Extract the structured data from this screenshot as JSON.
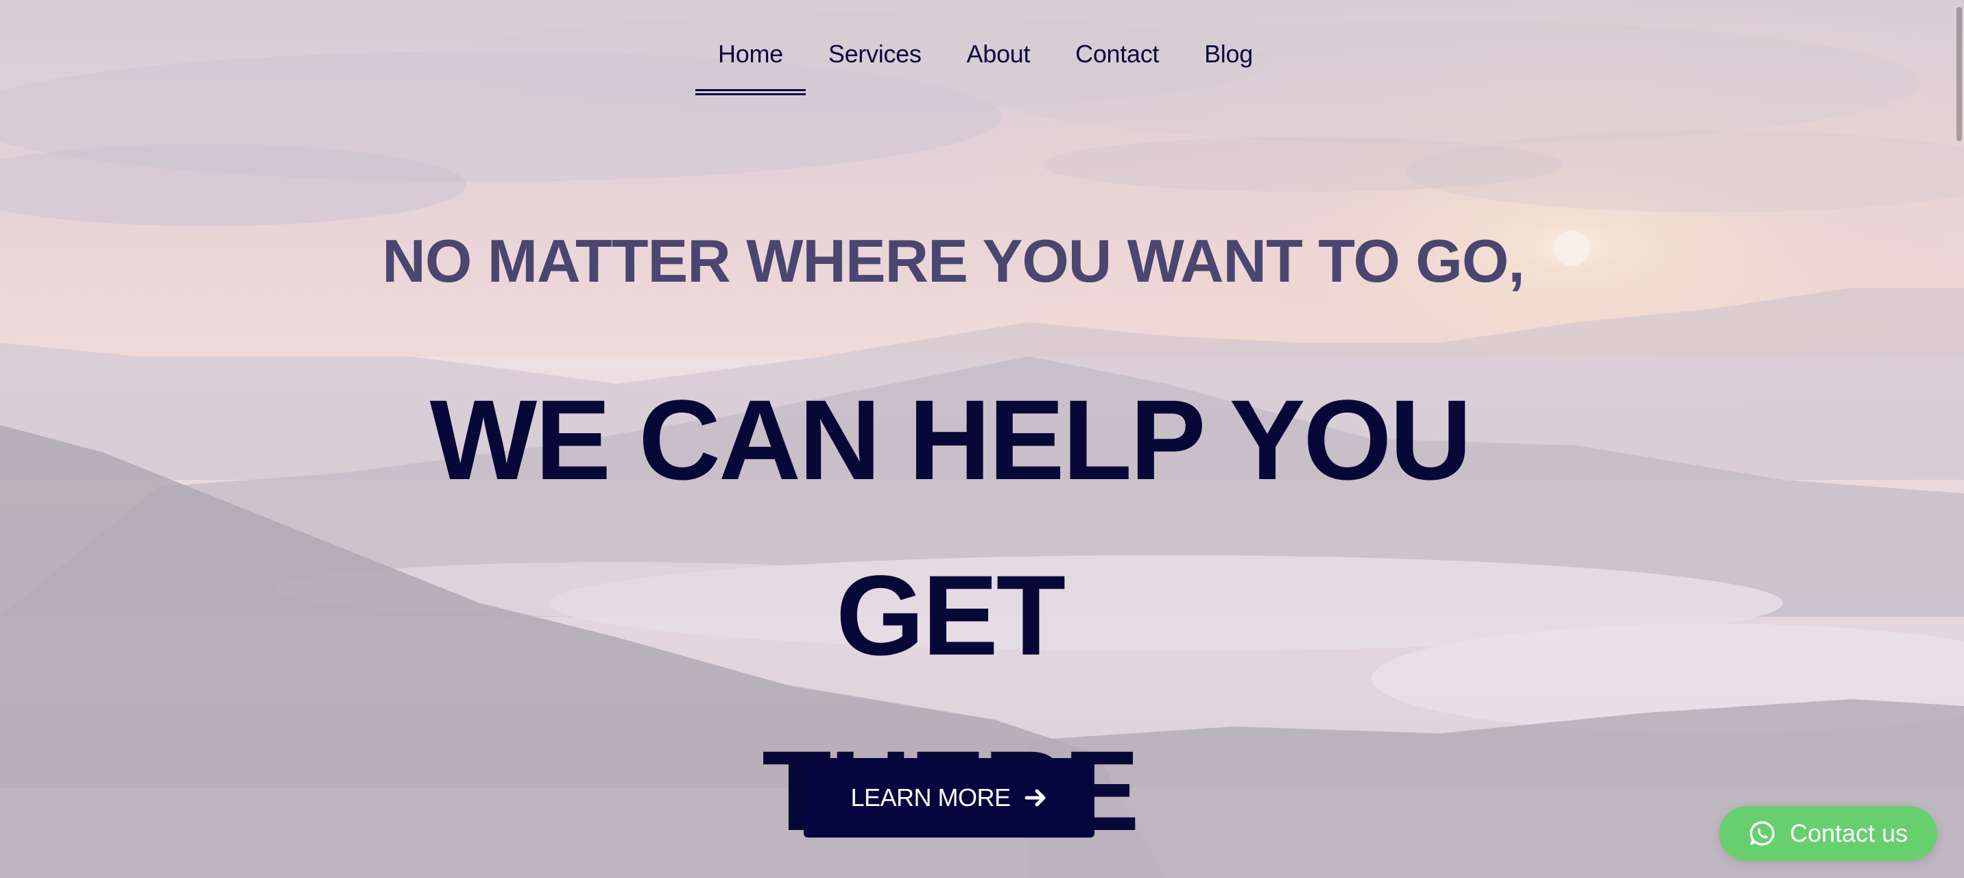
{
  "nav": {
    "items": [
      {
        "label": "Home",
        "active": true
      },
      {
        "label": "Services",
        "active": false
      },
      {
        "label": "About",
        "active": false
      },
      {
        "label": "Contact",
        "active": false
      },
      {
        "label": "Blog",
        "active": false
      }
    ]
  },
  "hero": {
    "kicker": "NO MATTER WHERE YOU WANT TO GO,",
    "title_line1": "WE CAN HELP YOU GET",
    "title_line2": "THERE"
  },
  "cta": {
    "label": "LEARN MORE",
    "icon": "arrow-right-icon"
  },
  "contact_float": {
    "label": "Contact us",
    "icon": "whatsapp-icon"
  },
  "colors": {
    "navy": "#06063e",
    "kicker": "#4a4670",
    "whatsapp_green": "#68cf6f"
  }
}
